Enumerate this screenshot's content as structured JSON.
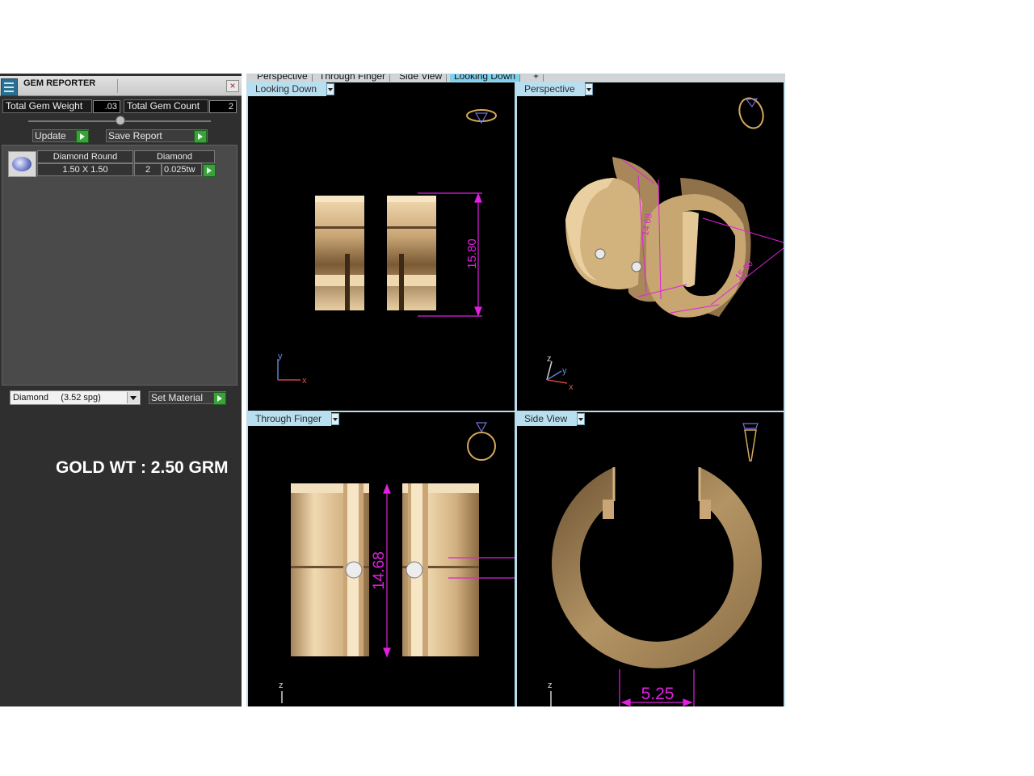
{
  "panel": {
    "title": "GEM REPORTER",
    "total_gem_weight_label": "Total Gem Weight",
    "total_gem_weight_value": ".03",
    "total_gem_count_label": "Total Gem Count",
    "total_gem_count_value": "2",
    "update_label": "Update",
    "save_report_label": "Save Report",
    "gem": {
      "shape": "Diamond Round",
      "material": "Diamond",
      "size": "1.50 X 1.50",
      "count": "2",
      "weight": "0.025tw"
    },
    "material_select": "Diamond     (3.52 spg)",
    "set_material_label": "Set Material",
    "gold_weight": "GOLD WT : 2.50 GRM"
  },
  "tabs": [
    "Perspective",
    "Through Finger",
    "Side View",
    "Looking Down",
    "+"
  ],
  "active_tab": "Looking Down",
  "viewports": {
    "top": {
      "label": "Looking Down",
      "dimension": "15.80",
      "axes": {
        "a": "y",
        "b": "x"
      }
    },
    "perspective": {
      "label": "Perspective",
      "dimension_a": "14.68",
      "dimension_b": "15.80",
      "axes": {
        "a": "z",
        "b": "y",
        "c": "x"
      }
    },
    "front": {
      "label": "Through Finger",
      "dimension": "14.68",
      "axes": {
        "a": "z"
      }
    },
    "side": {
      "label": "Side View",
      "dimension": "5.25",
      "axes": {
        "a": "z"
      }
    }
  },
  "colors": {
    "dimension": "#e020e0",
    "gold": "#d9b98a",
    "viewport_bg": "#000000",
    "label_bg": "#b7dff0",
    "panel_bg": "#2f2f2f"
  }
}
